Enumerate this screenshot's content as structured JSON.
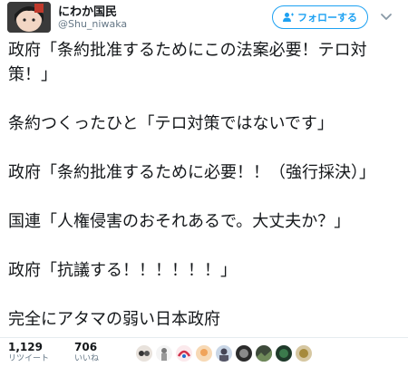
{
  "header": {
    "display_name": "にわか国民",
    "handle": "@Shu_niwaka",
    "follow_label": "フォローする"
  },
  "tweet": {
    "lines": [
      "政府「条約批准するためにこの法案必要！テロ対策！」",
      "条約つくったひと「テロ対策ではないです」",
      "政府「条約批准するために必要！！（強行採決）」",
      "国連「人権侵害のおそれあるで。大丈夫か？」",
      "政府「抗議する！！！！！！」",
      "完全にアタマの弱い日本政府"
    ]
  },
  "stats": {
    "retweets_count": "1,129",
    "retweets_label": "リツイート",
    "likes_count": "706",
    "likes_label": "いいね"
  },
  "colors": {
    "accent": "#1da1f2",
    "text": "#14171a",
    "muted": "#657786"
  },
  "icons": {
    "follow": "add-user-icon",
    "menu": "chevron-down-icon"
  }
}
